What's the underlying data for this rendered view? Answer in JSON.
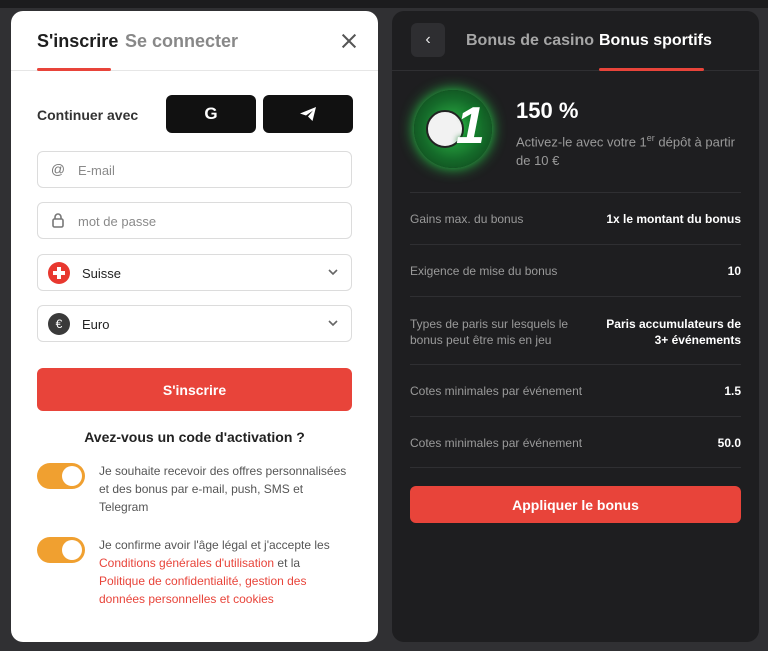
{
  "auth": {
    "tab_signup": "S'inscrire",
    "tab_login": "Se connecter",
    "continue_with": "Continuer avec",
    "google_label": "G",
    "email_placeholder": "E-mail",
    "password_placeholder": "mot de passe",
    "country": "Suisse",
    "currency": "Euro",
    "signup_button": "S'inscrire",
    "activation_code": "Avez-vous un code d'activation ?",
    "consent1": "Je souhaite recevoir des offres personnalisées et des bonus par e-mail, push, SMS et Telegram",
    "consent2_prefix": "Je confirme avoir l'âge légal et j'accepte les ",
    "consent2_link1": "Conditions générales d'utilisation",
    "consent2_mid": " et la ",
    "consent2_link2": "Politique de confidentialité, gestion des données personnelles et cookies"
  },
  "bonus": {
    "tab_casino": "Bonus de casino",
    "tab_sports": "Bonus sportifs",
    "badge_number": "1",
    "percent": "150 %",
    "desc_prefix": "Activez-le avec votre 1",
    "desc_sup": "er",
    "desc_suffix": " dépôt à partir de 10 €",
    "rows": [
      {
        "label": "Gains max. du bonus",
        "value": "1x le montant du bonus"
      },
      {
        "label": "Exigence de mise du bonus",
        "value": "10"
      },
      {
        "label": "Types de paris sur lesquels le bonus peut être mis en jeu",
        "value": "Paris accumulateurs de 3+ événements"
      },
      {
        "label": "Cotes minimales par événement",
        "value": "1.5"
      },
      {
        "label": "Cotes minimales par événement",
        "value": "50.0"
      }
    ],
    "apply_button": "Appliquer le bonus"
  },
  "colors": {
    "accent": "#e8443a",
    "toggle": "#f0a030",
    "dark_panel": "#1e1e20"
  }
}
